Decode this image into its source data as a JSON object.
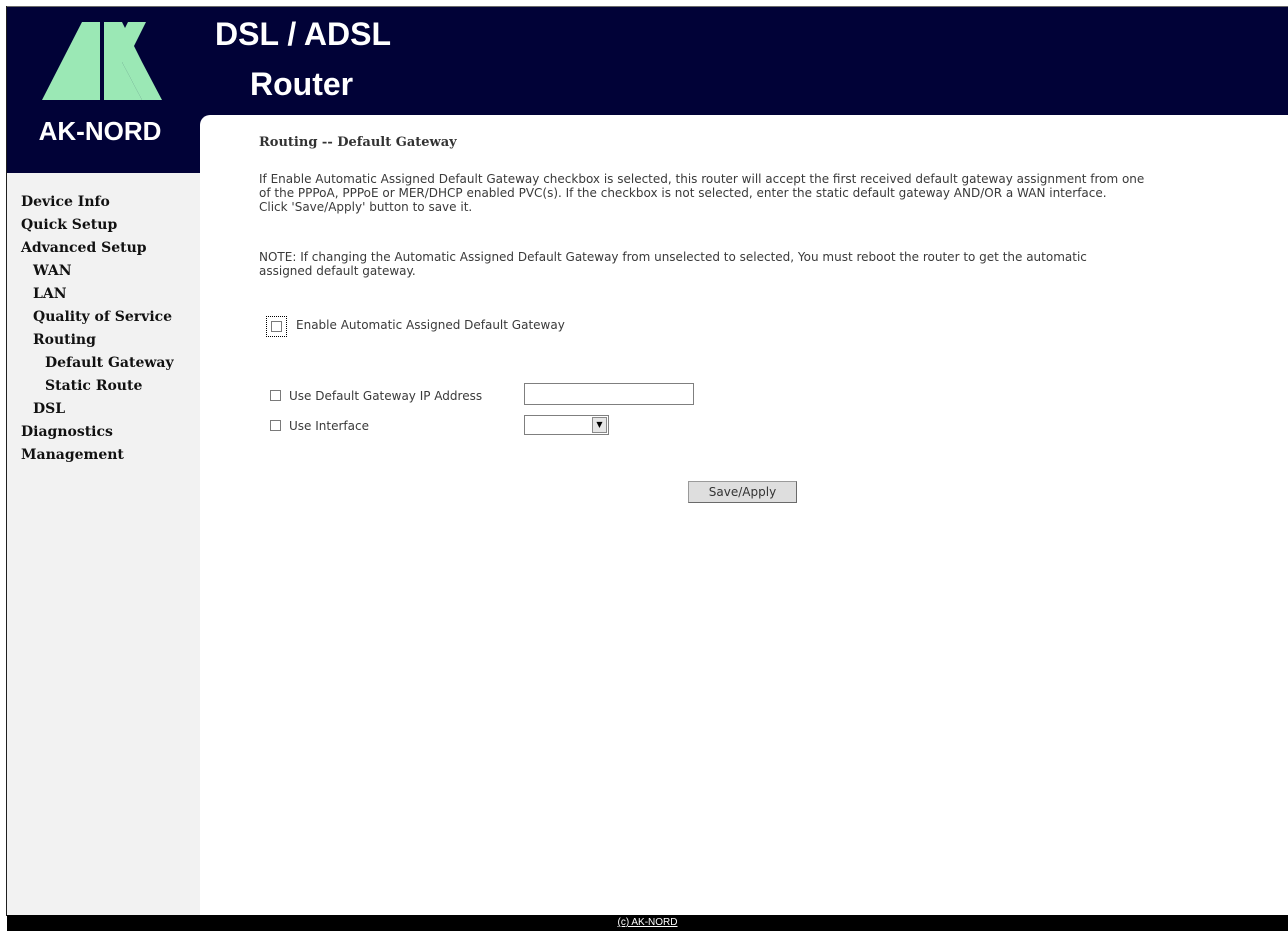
{
  "header": {
    "brand": "AK-NORD",
    "title_line1": "DSL / ADSL",
    "title_line2": "Router",
    "logo_icon": "ak-logo-icon"
  },
  "sidebar": {
    "items": [
      {
        "label": "Device Info"
      },
      {
        "label": "Quick Setup"
      },
      {
        "label": "Advanced Setup"
      },
      {
        "label": "WAN"
      },
      {
        "label": "LAN"
      },
      {
        "label": "Quality of Service"
      },
      {
        "label": "Routing"
      },
      {
        "label": "Default Gateway"
      },
      {
        "label": "Static Route"
      },
      {
        "label": "DSL"
      },
      {
        "label": "Diagnostics"
      },
      {
        "label": "Management"
      }
    ]
  },
  "main": {
    "heading": "Routing -- Default Gateway",
    "description": [
      "If Enable Automatic Assigned Default Gateway checkbox is selected, this router will accept the first received default gateway assignment from one",
      "of the PPPoA, PPPoE or MER/DHCP enabled PVC(s). If the checkbox is not selected, enter the static default gateway AND/OR a WAN interface.",
      "Click 'Save/Apply' button to save it."
    ],
    "note": [
      "NOTE: If changing the Automatic Assigned Default Gateway from unselected to selected, You must reboot the router to get the automatic",
      "assigned default gateway."
    ],
    "auto_gateway_label": "Enable Automatic Assigned Default Gateway",
    "use_gateway_ip_label": "Use Default Gateway IP Address",
    "gateway_ip_value": "",
    "use_interface_label": "Use Interface",
    "interface_selected": "",
    "save_label": "Save/Apply"
  },
  "footer": {
    "copyright": "(c) AK-NORD"
  },
  "colors": {
    "header_bg": "#010237",
    "sidebar_bg": "#f2f2f2",
    "logo_green": "#9be8b5",
    "footer_bg": "#000000"
  }
}
